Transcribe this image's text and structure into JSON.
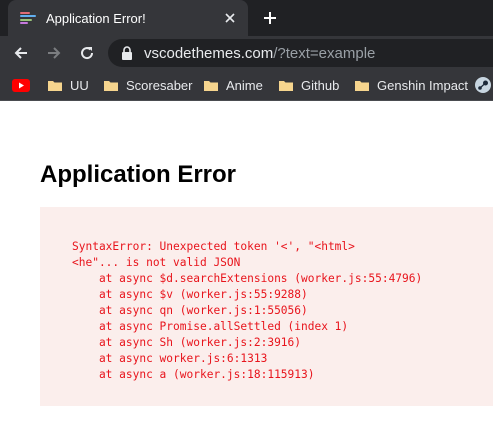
{
  "browser": {
    "tab": {
      "title": "Application Error!"
    },
    "omnibox": {
      "host": "vscodethemes.com",
      "path": "/?text=example"
    },
    "bookmarks": [
      {
        "label": "UU",
        "icon": "folder-icon"
      },
      {
        "label": "Scoresaber",
        "icon": "folder-icon"
      },
      {
        "label": "Anime",
        "icon": "folder-icon"
      },
      {
        "label": "Github",
        "icon": "folder-icon"
      },
      {
        "label": "Genshin Impact",
        "icon": "folder-icon"
      }
    ],
    "bookmark_icons": [
      "youtube-icon",
      "steam-icon"
    ]
  },
  "page": {
    "heading": "Application Error",
    "error_lines": [
      "SyntaxError: Unexpected token '<', \"<html>",
      "<he\"... is not valid JSON",
      "    at async $d.searchExtensions (worker.js:55:4796)",
      "    at async $v (worker.js:55:9288)",
      "    at async qn (worker.js:1:55056)",
      "    at async Promise.allSettled (index 1)",
      "    at async Sh (worker.js:2:3916)",
      "    at async worker.js:6:1313",
      "    at async a (worker.js:18:115913)"
    ]
  },
  "colors": {
    "chrome_dark": "#202124",
    "chrome_mid": "#35363a",
    "error_text": "#e8141c",
    "error_bg": "#fbeeec",
    "folder": "#f6d58e",
    "youtube": "#ff0000"
  }
}
